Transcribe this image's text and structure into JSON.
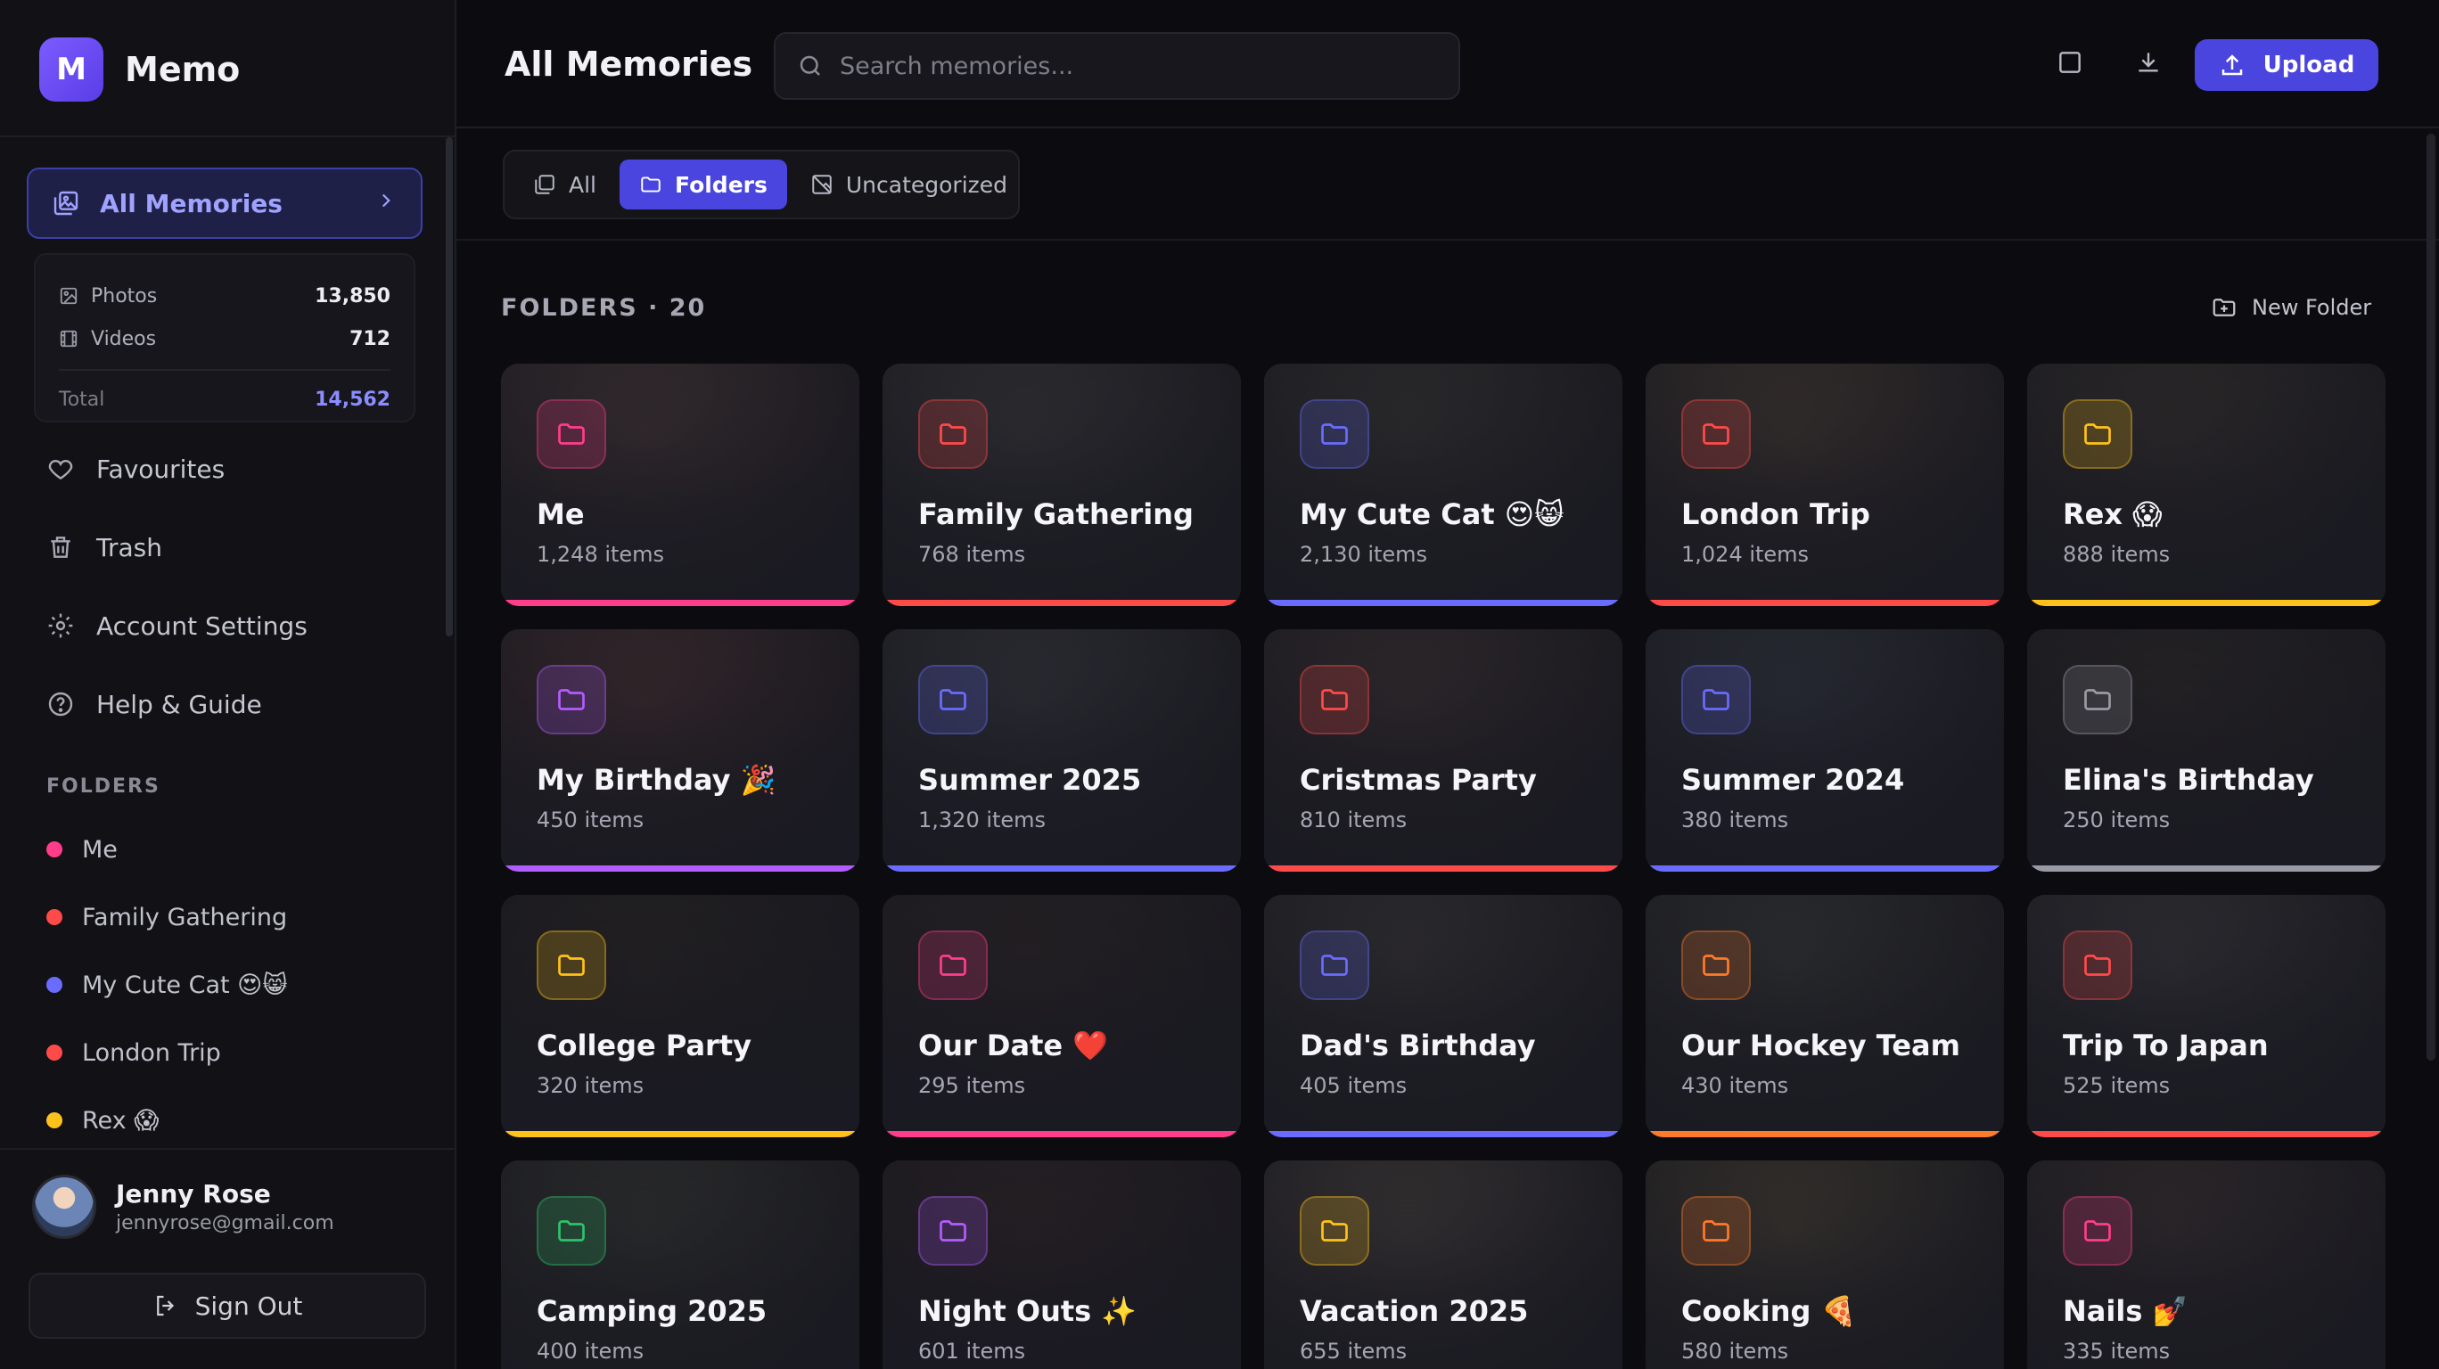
{
  "brand": {
    "logo_letter": "M",
    "name": "Memo"
  },
  "sidebar": {
    "all_memories": "All Memories",
    "stats": {
      "photos_label": "Photos",
      "photos_value": "13,850",
      "videos_label": "Videos",
      "videos_value": "712",
      "total_label": "Total",
      "total_value": "14,562"
    },
    "items": [
      {
        "label": "Favourites",
        "icon": "heart-icon"
      },
      {
        "label": "Trash",
        "icon": "trash-icon"
      },
      {
        "label": "Account Settings",
        "icon": "gear-icon"
      },
      {
        "label": "Help & Guide",
        "icon": "help-icon"
      }
    ],
    "folders_title": "FOLDERS",
    "folders": [
      {
        "label": "Me",
        "color": "#ff3d8b"
      },
      {
        "label": "Family Gathering",
        "color": "#ff4a4a"
      },
      {
        "label": "My Cute Cat 😍😸",
        "color": "#6a6cff"
      },
      {
        "label": "London Trip",
        "color": "#ff4a4a"
      },
      {
        "label": "Rex 😱",
        "color": "#ffc21a"
      }
    ]
  },
  "user": {
    "name": "Jenny Rose",
    "email": "jennyrose@gmail.com",
    "sign_out": "Sign Out"
  },
  "header": {
    "title": "All Memories",
    "search_placeholder": "Search memories...",
    "upload_label": "Upload"
  },
  "filters": {
    "all": "All",
    "folders": "Folders",
    "uncategorized": "Uncategorized",
    "active": "Folders"
  },
  "section": {
    "title": "FOLDERS · 20",
    "new_folder": "New Folder"
  },
  "cards": [
    {
      "title": "Me",
      "count": "1,248 items",
      "accent": "#ff3d8b",
      "bg": "#4b3a3a"
    },
    {
      "title": "Family Gathering",
      "count": "768 items",
      "accent": "#ff4a4a",
      "bg": "#3e3d40"
    },
    {
      "title": "My Cute Cat 😍😸",
      "count": "2,130 items",
      "accent": "#6a6cff",
      "bg": "#3a3836"
    },
    {
      "title": "London Trip",
      "count": "1,024 items",
      "accent": "#ff4a4a",
      "bg": "#4a3f36"
    },
    {
      "title": "Rex 😱",
      "count": "888 items",
      "accent": "#ffc21a",
      "bg": "#3a3530"
    },
    {
      "title": "My Birthday 🎉",
      "count": "450 items",
      "accent": "#b35cff",
      "bg": "#4a3335"
    },
    {
      "title": "Summer 2025",
      "count": "1,320 items",
      "accent": "#6a6cff",
      "bg": "#3a3c42"
    },
    {
      "title": "Cristmas Party",
      "count": "810 items",
      "accent": "#ff4a4a",
      "bg": "#3e3434"
    },
    {
      "title": "Summer 2024",
      "count": "380 items",
      "accent": "#6a6cff",
      "bg": "#353a44"
    },
    {
      "title": "Elina's Birthday",
      "count": "250 items",
      "accent": "#9a9aa6",
      "bg": "#2e2a28"
    },
    {
      "title": "College Party",
      "count": "320 items",
      "accent": "#ffc21a",
      "bg": "#2a2624"
    },
    {
      "title": "Our Date ❤️",
      "count": "295 items",
      "accent": "#ff3d8b",
      "bg": "#2e2828"
    },
    {
      "title": "Dad's Birthday",
      "count": "405 items",
      "accent": "#6a6cff",
      "bg": "#3c3a3a"
    },
    {
      "title": "Our Hockey Team",
      "count": "430 items",
      "accent": "#ff7a2a",
      "bg": "#3a3c3a"
    },
    {
      "title": "Trip To Japan",
      "count": "525 items",
      "accent": "#ff4a4a",
      "bg": "#3e3c40"
    },
    {
      "title": "Camping 2025",
      "count": "400 items",
      "accent": "#2ec26a",
      "bg": "#383a36"
    },
    {
      "title": "Night Outs ✨",
      "count": "601 items",
      "accent": "#b35cff",
      "bg": "#302628"
    },
    {
      "title": "Vacation 2025",
      "count": "655 items",
      "accent": "#ffc21a",
      "bg": "#4a4440"
    },
    {
      "title": "Cooking 🍕",
      "count": "580 items",
      "accent": "#ff7a2a",
      "bg": "#4a4436"
    },
    {
      "title": "Nails 💅",
      "count": "335 items",
      "accent": "#ff3d8b",
      "bg": "#3c3434"
    }
  ]
}
